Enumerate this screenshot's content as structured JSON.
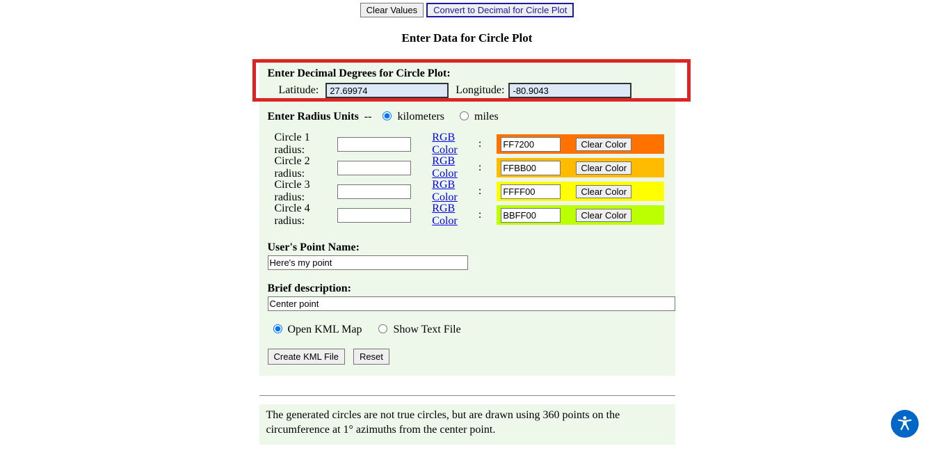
{
  "topButtons": {
    "clear": "Clear Values",
    "convert": "Convert to Decimal for Circle Plot"
  },
  "sectionTitle": "Enter Data for Circle Plot",
  "coords": {
    "heading": "Enter Decimal Degrees for Circle Plot:",
    "latLabel": "Latitude:",
    "latValue": "27.69974",
    "lonLabel": "Longitude:",
    "lonValue": "-80.9043"
  },
  "radiusUnits": {
    "label": "Enter Radius Units",
    "km": "kilometers",
    "miles": "miles"
  },
  "circles": [
    {
      "label": "Circle 1 radius:",
      "rgb": "FF7200",
      "bg": "#FF7200"
    },
    {
      "label": "Circle 2 radius:",
      "rgb": "FFBB00",
      "bg": "#FFBB00"
    },
    {
      "label": "Circle 3 radius:",
      "rgb": "FFFF00",
      "bg": "#FFFF00"
    },
    {
      "label": "Circle 4 radius:",
      "rgb": "BBFF00",
      "bg": "#BBFF00"
    }
  ],
  "rgbLink": "RGB Color",
  "clearColor": "Clear Color",
  "pointName": {
    "label": "User's Point Name:",
    "value": "Here's my point"
  },
  "desc": {
    "label": "Brief description:",
    "value": "Center point"
  },
  "output": {
    "kml": "Open KML Map",
    "text": "Show Text File"
  },
  "actions": {
    "create": "Create KML File",
    "reset": "Reset"
  },
  "note": "The generated circles are not true circles, but are drawn using 360 points on the circumference at 1° azimuths from the center point."
}
